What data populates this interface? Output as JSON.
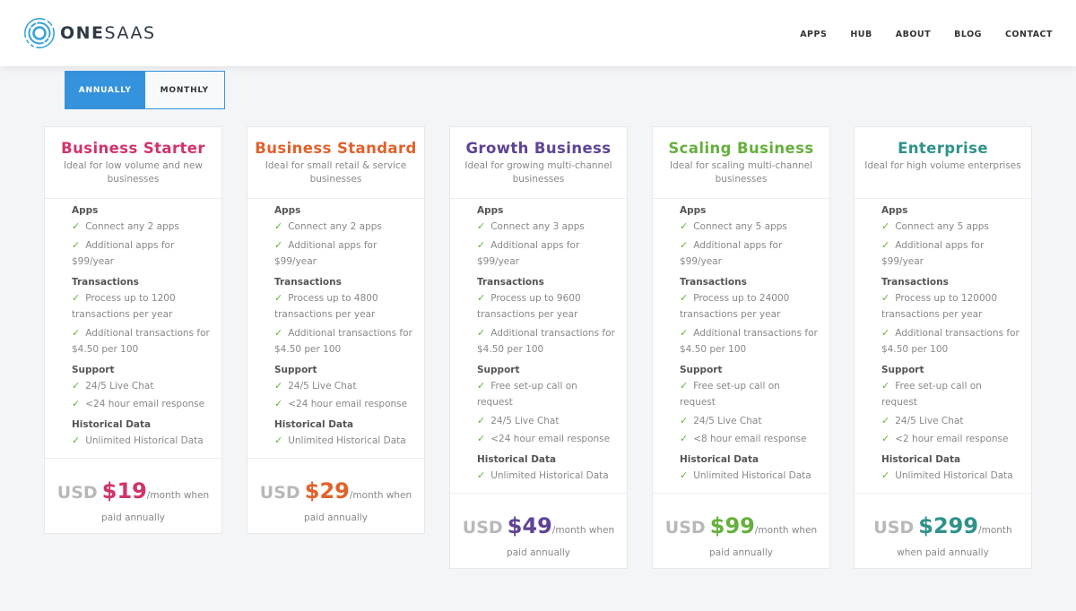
{
  "header": {
    "logo_bold": "ONE",
    "logo_light": "SAAS",
    "nav": [
      "APPS",
      "HUB",
      "ABOUT",
      "BLOG",
      "CONTACT"
    ]
  },
  "billing_toggle": {
    "options": [
      "ANNUALLY",
      "MONTHLY"
    ],
    "selected": "ANNUALLY"
  },
  "plans": [
    {
      "name": "Business Starter",
      "color": "#d1336c",
      "subtitle": "Ideal for low volume and new businesses",
      "sections": [
        {
          "title": "Apps",
          "features": [
            "Connect any 2 apps",
            "Additional apps for $99/year"
          ]
        },
        {
          "title": "Transactions",
          "features": [
            "Process up to 1200 transactions per year",
            "Additional transactions for $4.50 per 100"
          ]
        },
        {
          "title": "Support",
          "features": [
            "24/5 Live Chat",
            "<24 hour email response"
          ]
        },
        {
          "title": "Historical Data",
          "features": [
            "Unlimited Historical Data"
          ]
        }
      ],
      "currency": "USD",
      "price": "$19",
      "per": "/month when",
      "paid": "paid annually"
    },
    {
      "name": "Business Standard",
      "color": "#e0622b",
      "subtitle": "Ideal for small retail & service businesses",
      "sections": [
        {
          "title": "Apps",
          "features": [
            "Connect any 2 apps",
            "Additional apps for $99/year"
          ]
        },
        {
          "title": "Transactions",
          "features": [
            "Process up to 4800 transactions per year",
            "Additional transactions for $4.50 per 100"
          ]
        },
        {
          "title": "Support",
          "features": [
            "24/5 Live Chat",
            "<24 hour email response"
          ]
        },
        {
          "title": "Historical Data",
          "features": [
            "Unlimited Historical Data"
          ]
        }
      ],
      "currency": "USD",
      "price": "$29",
      "per": "/month when",
      "paid": "paid annually"
    },
    {
      "name": "Growth Business",
      "color": "#5e4396",
      "subtitle": "Ideal for growing multi-channel businesses",
      "sections": [
        {
          "title": "Apps",
          "features": [
            "Connect any 3 apps",
            "Additional apps for $99/year"
          ]
        },
        {
          "title": "Transactions",
          "features": [
            "Process up to 9600 transactions per year",
            "Additional transactions for $4.50 per 100"
          ]
        },
        {
          "title": "Support",
          "features": [
            "Free set-up call on request",
            "24/5 Live Chat",
            "<24 hour email response"
          ]
        },
        {
          "title": "Historical Data",
          "features": [
            "Unlimited Historical Data"
          ]
        }
      ],
      "currency": "USD",
      "price": "$49",
      "per": "/month when",
      "paid": "paid annually"
    },
    {
      "name": "Scaling Business",
      "color": "#66b03d",
      "subtitle": "Ideal for scaling multi-channel businesses",
      "sections": [
        {
          "title": "Apps",
          "features": [
            "Connect any 5 apps",
            "Additional apps for $99/year"
          ]
        },
        {
          "title": "Transactions",
          "features": [
            "Process up to 24000 transactions per year",
            "Additional transactions for $4.50 per 100"
          ]
        },
        {
          "title": "Support",
          "features": [
            "Free set-up call on request",
            "24/5 Live Chat",
            "<8 hour email response"
          ]
        },
        {
          "title": "Historical Data",
          "features": [
            "Unlimited Historical Data"
          ]
        }
      ],
      "currency": "USD",
      "price": "$99",
      "per": "/month when",
      "paid": "paid annually"
    },
    {
      "name": "Enterprise",
      "color": "#2f928a",
      "subtitle": "Ideal for high volume enterprises",
      "sections": [
        {
          "title": "Apps",
          "features": [
            "Connect any 5 apps",
            "Additional apps for $99/year"
          ]
        },
        {
          "title": "Transactions",
          "features": [
            "Process up to 120000 transactions per year",
            "Additional transactions for $4.50 per 100"
          ]
        },
        {
          "title": "Support",
          "features": [
            "Free set-up call on request",
            "24/5 Live Chat",
            "<2 hour email response"
          ]
        },
        {
          "title": "Historical Data",
          "features": [
            "Unlimited Historical Data"
          ]
        }
      ],
      "currency": "USD",
      "price": "$299",
      "per": "/month",
      "paid": "when paid annually"
    }
  ],
  "check_icon": "✓"
}
